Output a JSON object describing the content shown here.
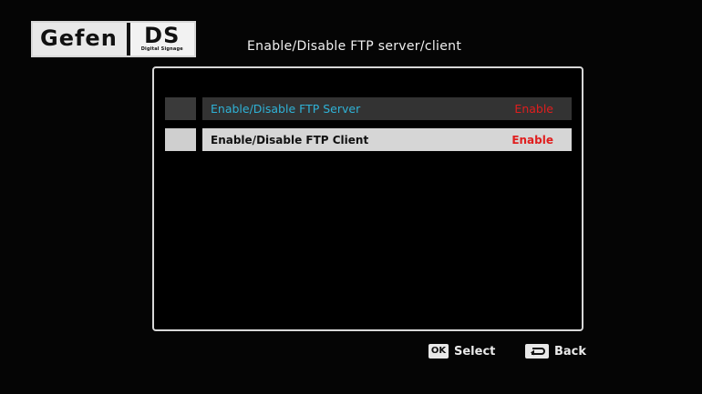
{
  "logo": {
    "brand": "Gefen",
    "product": "DS",
    "product_sub": "Digital Signage"
  },
  "header": {
    "title": "Enable/Disable FTP server/client"
  },
  "menu": {
    "items": [
      {
        "label": "Enable/Disable FTP Server",
        "value": "Enable",
        "state": "selected"
      },
      {
        "label": "Enable/Disable FTP Client",
        "value": "Enable",
        "state": "normal"
      }
    ]
  },
  "footer": {
    "ok_key": "OK",
    "select_label": "Select",
    "back_icon": "back-arrow-icon",
    "back_label": "Back"
  },
  "colors": {
    "selected_text": "#2fb2d6",
    "value_text": "#e01e1e",
    "selected_bar": "#333333",
    "normal_bar": "#d6d6d6"
  }
}
